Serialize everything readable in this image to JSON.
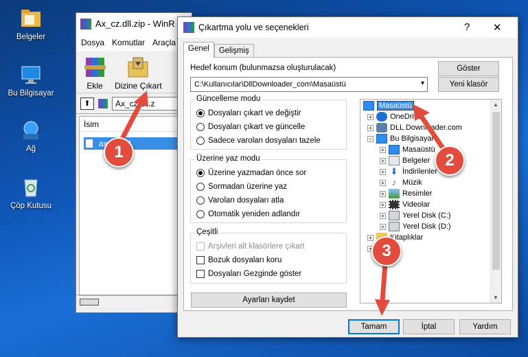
{
  "desktop": {
    "icons": [
      {
        "label": "Belgeler"
      },
      {
        "label": "Bu Bilgisayar"
      },
      {
        "label": "Ağ"
      },
      {
        "label": "Çöp Kutusu"
      }
    ]
  },
  "winrar": {
    "title": "Ax_cz.dll.zip - WinR",
    "menu": [
      "Dosya",
      "Komutlar",
      "Araçla"
    ],
    "toolbar": {
      "add_label": "Ekle",
      "extract_label": "Dizine Çıkart"
    },
    "address": "Ax_cz.dll.z",
    "list_header": "İsim",
    "file_row": "ax_cz.dll"
  },
  "dialog": {
    "title": "Çıkartma yolu ve seçenekleri",
    "help": "?",
    "tabs": [
      "Genel",
      "Gelişmiş"
    ],
    "dest_label": "Hedef konum (bulunmazsa oluşturulacak)",
    "dest_value": "C:\\Kullanıcılar\\DllDownloader_com\\Masaüstü",
    "show_button": "Göster",
    "new_folder_button": "Yeni klasör",
    "update_group": {
      "title": "Güncelleme modu",
      "options": [
        "Dosyaları çıkart ve değiştir",
        "Dosyaları çıkart ve güncelle",
        "Sadece varolan dosyaları tazele"
      ],
      "selected": 0
    },
    "overwrite_group": {
      "title": "Üzerine yaz modu",
      "options": [
        "Üzerine yazmadan önce sor",
        "Sormadan üzerine yaz",
        "Varolan dosyaları atla",
        "Otomatik yeniden adlandır"
      ],
      "selected": 0
    },
    "misc_group": {
      "title": "Çeşitli",
      "options": [
        "Arşivleri alt klasörlere çıkart",
        "Bozuk dosyaları koru",
        "Dosyaları Gezginde göster"
      ]
    },
    "save_settings_button": "Ayarları kaydet",
    "tree": [
      {
        "label": "Masaüstü"
      },
      {
        "label": "OneDrive"
      },
      {
        "label": "DLL Downloader.com"
      },
      {
        "label": "Bu Bilgisayar"
      },
      {
        "label": "Masaüstü"
      },
      {
        "label": "Belgeler"
      },
      {
        "label": "İndirilenler"
      },
      {
        "label": "Müzik"
      },
      {
        "label": "Resimler"
      },
      {
        "label": "Videolar"
      },
      {
        "label": "Yerel Disk (C:)"
      },
      {
        "label": "Yerel Disk (D:)"
      },
      {
        "label": "Kitaplıklar"
      }
    ],
    "ok_button": "Tamam",
    "cancel_button": "İptal",
    "help_button": "Yardım"
  },
  "steps": [
    "1",
    "2",
    "3"
  ],
  "colors": {
    "accent": "#e34c3c",
    "selection": "#3a8ee6",
    "folder": "#f2c94c"
  }
}
